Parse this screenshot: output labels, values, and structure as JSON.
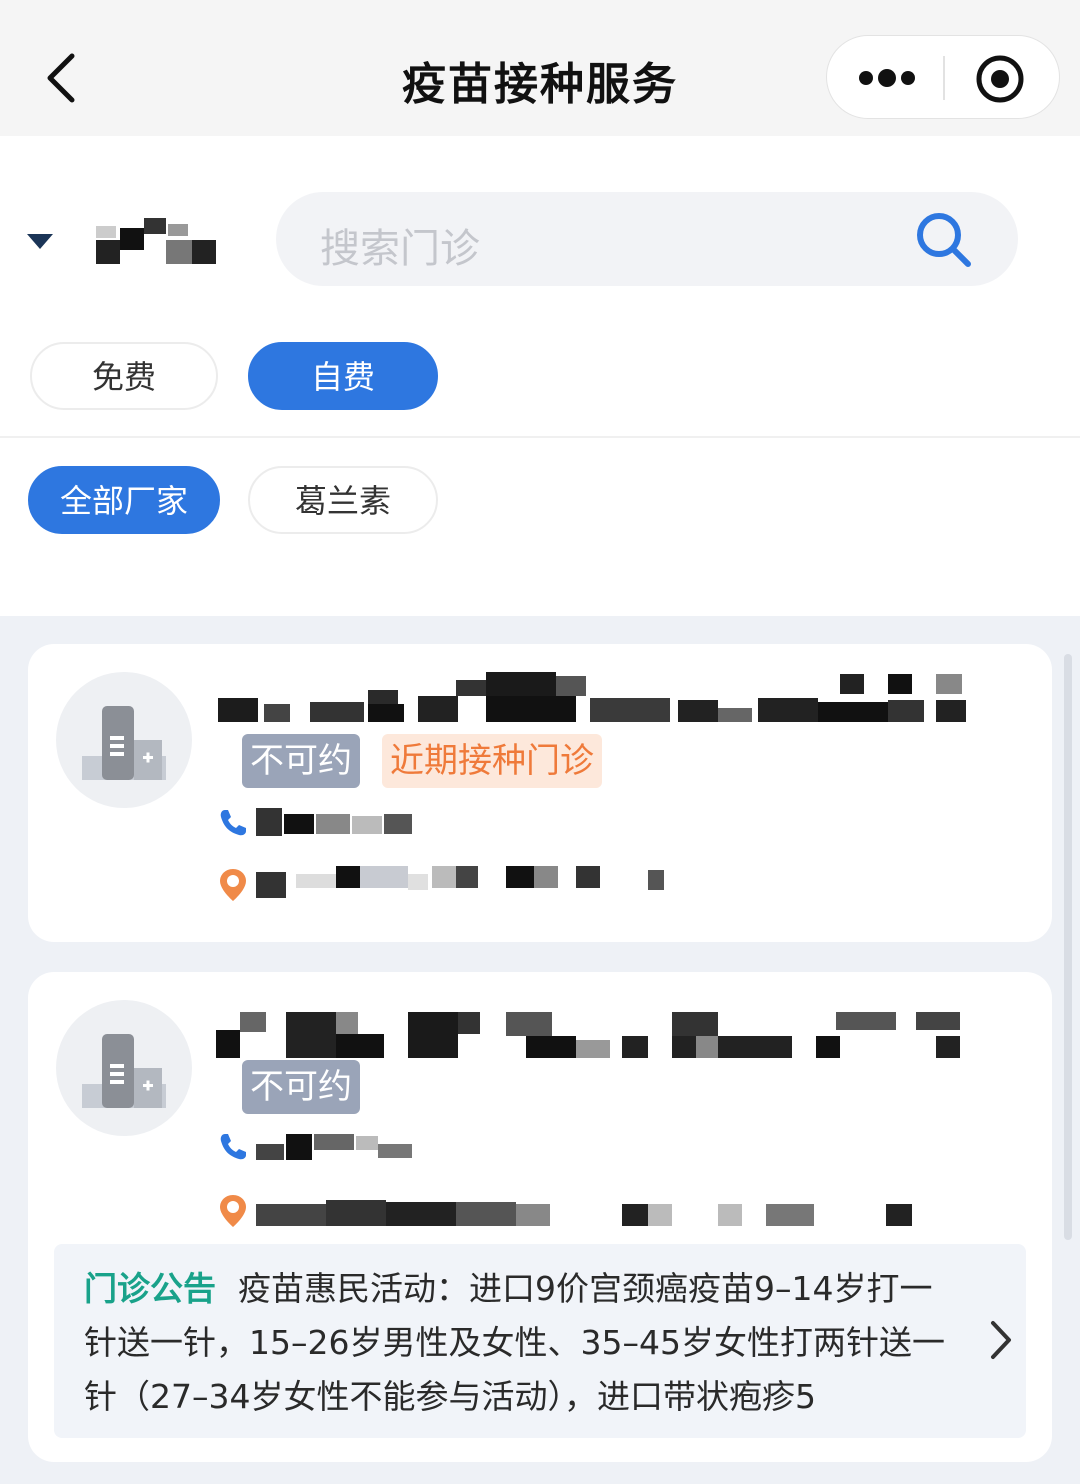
{
  "header": {
    "title": "疫苗接种服务",
    "back_icon": "chevron-left-icon",
    "more_icon": "more-dots-icon",
    "close_icon": "target-circle-icon"
  },
  "filters": {
    "region_caret_icon": "caret-down-icon",
    "search": {
      "placeholder": "搜索门诊",
      "icon": "search-icon"
    },
    "fee_types": [
      {
        "label": "免费",
        "active": false
      },
      {
        "label": "自费",
        "active": true
      }
    ],
    "manufacturers": [
      {
        "label": "全部厂家",
        "active": true
      },
      {
        "label": "葛兰素",
        "active": false
      }
    ]
  },
  "clinics": [
    {
      "tags": [
        {
          "label": "不可约",
          "style": "gray"
        },
        {
          "label": "近期接种门诊",
          "style": "orange"
        }
      ],
      "phone_icon": "phone-icon",
      "address_icon": "location-pin-icon"
    },
    {
      "tags": [
        {
          "label": "不可约",
          "style": "gray"
        }
      ],
      "phone_icon": "phone-icon",
      "address_icon": "location-pin-icon",
      "notice": {
        "label": "门诊公告",
        "text": "疫苗惠民活动：进口9价宫颈癌疫苗9–14岁打一针送一针，15–26岁男性及女性、35–45岁女性打两针送一针（27–34岁女性不能参与活动），进口带状疱疹5",
        "arrow_icon": "chevron-right-icon"
      }
    }
  ],
  "colors": {
    "accent": "#2e77e0",
    "unavailable_tag": "#9aa4b8",
    "recent_tag_bg": "#fde8db",
    "recent_tag_text": "#ef7a3a",
    "notice_label": "#19a28a",
    "location_pin": "#f08a48"
  }
}
